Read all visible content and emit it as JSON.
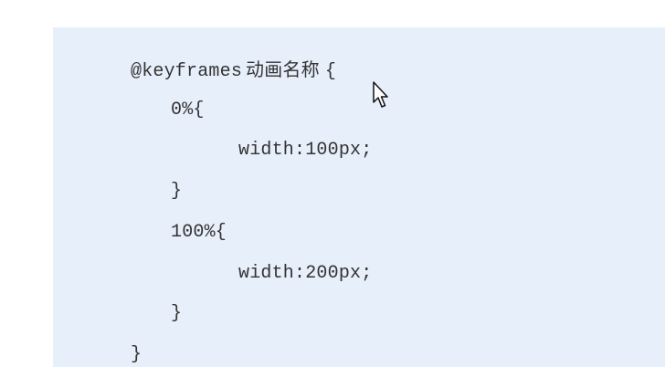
{
  "code": {
    "line0_prefix": "@keyframes",
    "line0_name": "动画名称",
    "line0_suffix": "{",
    "line1": "0%{",
    "line2": "width:100px;",
    "line3": "}",
    "line4": "100%{",
    "line5": "width:200px;",
    "line6": "}",
    "line7": "}"
  },
  "icons": {
    "cursor": "mouse-pointer-icon"
  }
}
